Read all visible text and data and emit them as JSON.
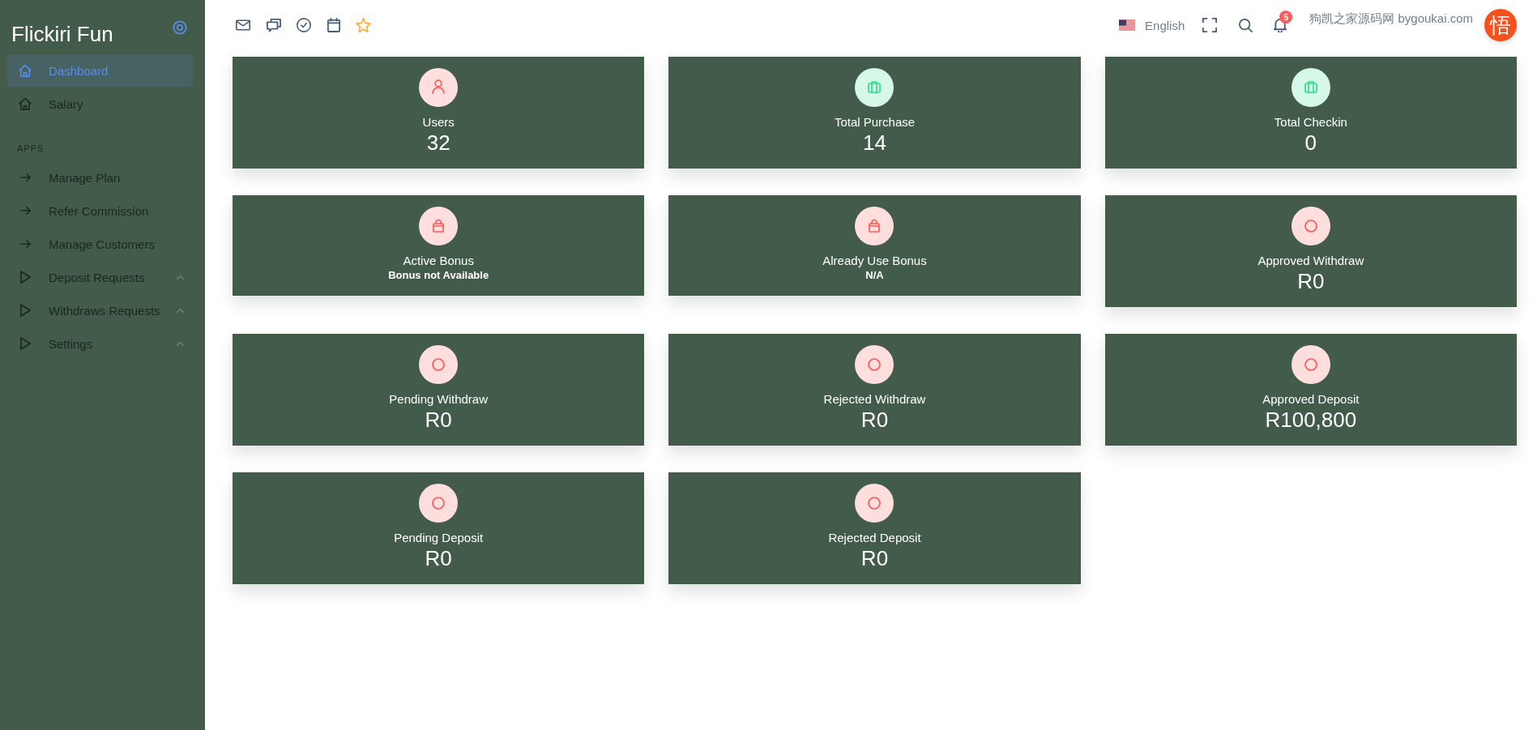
{
  "sidebar": {
    "brand": "Flickiri Fun",
    "items": [
      {
        "label": "Dashboard",
        "kind": "page",
        "selected": true
      },
      {
        "label": "Salary",
        "kind": "page",
        "selected": false
      }
    ],
    "sections": [
      {
        "title": "APPS",
        "items": [
          {
            "label": "Manage Plan",
            "kind": "link",
            "selected": false
          },
          {
            "label": "Refer Commission",
            "kind": "link",
            "selected": false
          },
          {
            "label": "Manage Customers",
            "kind": "link",
            "selected": false
          },
          {
            "label": "Deposit Requests",
            "kind": "group",
            "selected": false
          },
          {
            "label": "Withdraws Requests",
            "kind": "group",
            "selected": false
          },
          {
            "label": "Settings",
            "kind": "group",
            "selected": false
          }
        ]
      }
    ]
  },
  "top_bar": {
    "language": "English",
    "notifications": "5",
    "user_name": "狗凯之家源码网 bygoukai.com",
    "avatar_text": "悟"
  },
  "cards": [
    {
      "kind": "person",
      "color": "#ffdede",
      "title": "Users",
      "value": "32"
    },
    {
      "kind": "briefcase",
      "color": "#d6f8e8",
      "title": "Total Purchase",
      "value": "14"
    },
    {
      "kind": "briefcase",
      "color": "#d6f8e8",
      "title": "Total Checkin",
      "value": "0"
    },
    {
      "kind": "bag",
      "color": "#ffdede",
      "title": "Active Bonus",
      "note": "Bonus not Available"
    },
    {
      "kind": "bag",
      "color": "#ffdede",
      "title": "Already Use Bonus",
      "note": "N/A"
    },
    {
      "kind": "ring",
      "color": "#ffdede",
      "title": "Approved Withdraw",
      "value": "R0"
    },
    {
      "kind": "ring",
      "color": "#ffdede",
      "title": "Pending Withdraw",
      "value": "R0"
    },
    {
      "kind": "ring",
      "color": "#ffdede",
      "title": "Rejected Withdraw",
      "value": "R0"
    },
    {
      "kind": "ring",
      "color": "#ffdede",
      "title": "Approved Deposit",
      "value": "R100,800"
    },
    {
      "kind": "ring",
      "color": "#ffdede",
      "title": "Pending Deposit",
      "value": "R0"
    },
    {
      "kind": "ring",
      "color": "#ffdede",
      "title": "Rejected Deposit",
      "value": "R0"
    }
  ]
}
